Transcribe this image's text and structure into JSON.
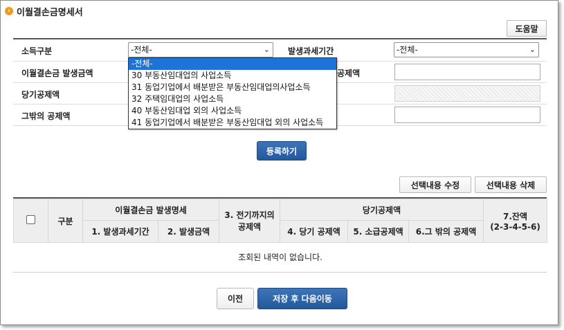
{
  "title": "이월결손금명세서",
  "help_label": "도움말",
  "form": {
    "income_type_label": "소득구분",
    "income_type_value": "-전체-",
    "period_label": "발생과세기간",
    "period_value": "-전체-",
    "loss_amount_label": "이월결손금 발생금액",
    "right_row2_label_visible": "공제액",
    "current_deduction_label": "당기공제액",
    "other_deduction_label": "그밖의 공제액"
  },
  "dropdown_options": [
    "-전체-",
    "30 부동산임대업의 사업소득",
    "31 동업기업에서 배분받은 부동산임대업의사업소득",
    "32 주택임대업의 사업소득",
    "40 부동산임대업 외의 사업소득",
    "41 동업기업에서 배분받은 부동산임대업 외의 사업소득"
  ],
  "register_label": "등록하기",
  "edit_selected_label": "선택내용 수정",
  "delete_selected_label": "선택내용 삭제",
  "table": {
    "col_category": "구분",
    "group_loss": "이월결손금 발생명세",
    "col_period": "1. 발생과세기간",
    "col_amount": "2. 발생금액",
    "col_prior_line1": "3. 전기까지의",
    "col_prior_line2": "공제액",
    "group_current": "당기공제액",
    "col_current": "4. 당기 공제액",
    "col_refund": "5. 소급공제액",
    "col_other": "6.그 밖의 공제액",
    "col_balance_line1": "7.잔액",
    "col_balance_line2": "(2-3-4-5-6)",
    "empty_message": "조회된 내역이 없습니다."
  },
  "prev_label": "이전",
  "save_next_label": "저장 후 다음이동"
}
